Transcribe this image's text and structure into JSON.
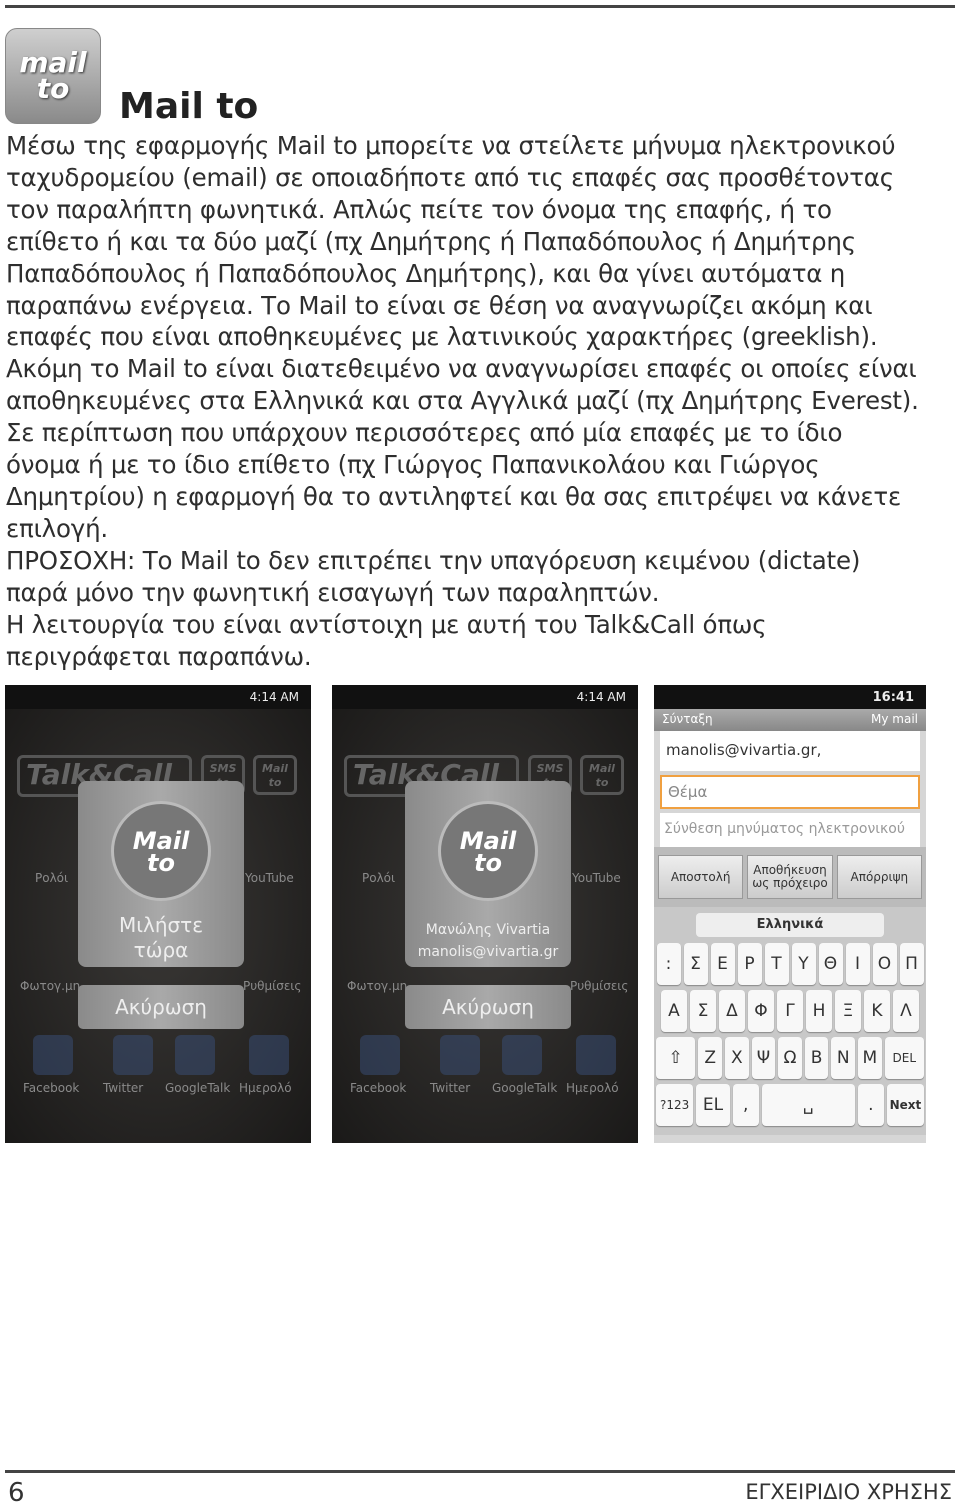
{
  "header": {
    "logo_text": [
      "mail",
      "to"
    ],
    "title": "Mail to"
  },
  "body_lines": [
    "Μέσω της εφαρμογής Mail to μπορείτε να στείλετε μήνυμα ηλεκτρονικού",
    "ταχυδρομείου (email) σε οποιαδήποτε από τις επαφές σας προσθέτοντας",
    "τον παραλήπτη φωνητικά. Απλώς πείτε τον όνομα της επαφής, ή το",
    "επίθετο ή και τα δύο μαζί (πχ Δημήτρης ή Παπαδόπουλος ή Δημήτρης",
    "Παπαδόπουλος ή Παπαδόπουλος Δημήτρης), και θα γίνει αυτόματα η",
    "παραπάνω ενέργεια. Το Mail to είναι σε θέση να αναγνωρίζει ακόμη και",
    "επαφές που είναι αποθηκευμένες με λατινικούς χαρακτήρες (greeklish).",
    "Ακόμη το Mail to είναι διατεθειμένο να αναγνωρίσει επαφές οι οποίες είναι",
    "αποθηκευμένες στα Ελληνικά και στα Αγγλικά μαζί (πχ Δημήτρης Everest).",
    "Σε περίπτωση που υπάρχουν περισσότερες από μία επαφές με το ίδιο",
    "όνομα ή με το ίδιο επίθετο (πχ Γιώργος Παπανικολάου και Γιώργος",
    "Δημητρίου) η εφαρμογή θα το αντιληφτεί και θα σας επιτρέψει να κάνετε",
    "επιλογή.",
    "ΠΡΟΣΟΧΗ: Το Mail to δεν επιτρέπει την υπαγόρευση κειμένου (dictate)",
    "παρά μόνο την φωνητική εισαγωγή των παραληπτών.",
    "Η λειτουργία του είναι αντίστοιχη με αυτή του Talk&Call όπως",
    "περιγράφεται παραπάνω."
  ],
  "screens": [
    {
      "time": "4:14 AM",
      "brand": "Talk&Call",
      "mini": [
        "SMS to",
        "Mail to"
      ],
      "apps": [
        "Ρολόι",
        "YouTube",
        "Φωτογ.μη",
        "Ρυθμίσεις",
        "Facebook",
        "Twitter",
        "GoogleTalk",
        "Ημερολό"
      ],
      "dialog_logo": [
        "Mail",
        "to"
      ],
      "dialog_text": [
        "Μιλήστε",
        "τώρα"
      ],
      "cancel": "Ακύρωση"
    },
    {
      "time": "4:14 AM",
      "brand": "Talk&Call",
      "mini": [
        "SMS to",
        "Mail to"
      ],
      "apps": [
        "Ρολόι",
        "YouTube",
        "Φωτογ.μη",
        "Ρυθμίσεις",
        "Facebook",
        "Twitter",
        "GoogleTalk",
        "Ημερολό"
      ],
      "dialog_logo": [
        "Mail",
        "to"
      ],
      "dialog_text": [
        "Μανώλης Vivartia",
        "manolis@vivartia.gr"
      ],
      "cancel": "Ακύρωση"
    }
  ],
  "mail_screen": {
    "time": "16:41",
    "title": "Σύνταξη",
    "account": "My mail",
    "to": "manolis@vivartia.gr,",
    "subject_placeholder": "Θέμα",
    "compose_placeholder": "Σύνθεση μηνύματος ηλεκτρονικού",
    "buttons": [
      "Αποστολή",
      "Αποθήκευση ως πρόχειρο",
      "Απόρριψη"
    ],
    "language": "Ελληνικά",
    "rows": [
      [
        ":",
        "Σ",
        "Ε",
        "Ρ",
        "Τ",
        "Υ",
        "Θ",
        "Ι",
        "Ο",
        "Π"
      ],
      [
        "Α",
        "Σ",
        "Δ",
        "Φ",
        "Γ",
        "Η",
        "Ξ",
        "Κ",
        "Λ"
      ],
      [
        "⇧",
        "Ζ",
        "Χ",
        "Ψ",
        "Ω",
        "Β",
        "Ν",
        "Μ",
        "DEL"
      ],
      [
        "?123",
        "EL",
        ",",
        "␣",
        ".",
        "Next"
      ]
    ]
  },
  "footer": {
    "page": "6",
    "label": "ΕΓΧΕΙΡΙΔΙΟ ΧΡΗΣΗΣ"
  }
}
